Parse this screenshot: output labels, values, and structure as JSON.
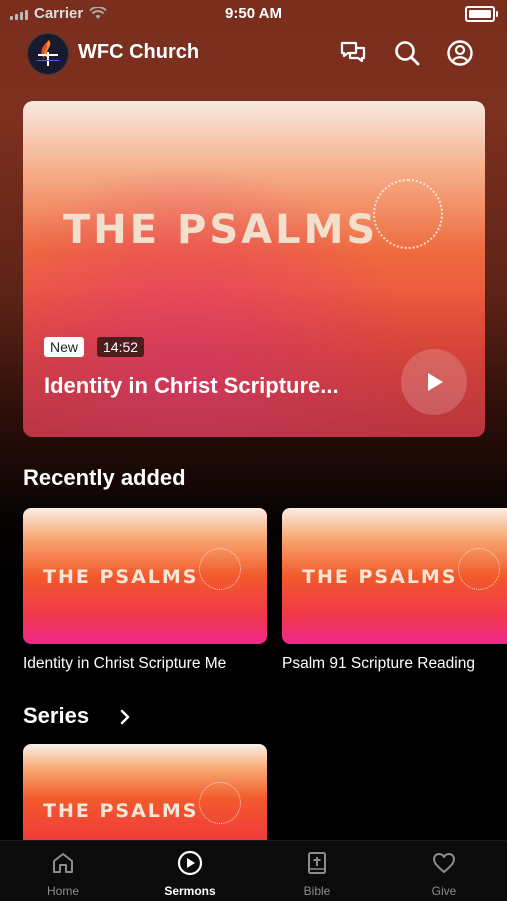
{
  "status_bar": {
    "carrier": "Carrier",
    "time": "9:50 AM"
  },
  "header": {
    "title": "WFC Church"
  },
  "hero": {
    "artwork_title": "THE PSALMS",
    "badge_new": "New",
    "duration": "14:52",
    "title": "Identity in Christ Scripture..."
  },
  "recently_added": {
    "heading": "Recently added",
    "items": [
      {
        "artwork_title": "THE PSALMS",
        "title": "Identity in Christ Scripture Me"
      },
      {
        "artwork_title": "THE PSALMS",
        "title": "Psalm 91 Scripture Reading"
      }
    ]
  },
  "series": {
    "heading": "Series",
    "items": [
      {
        "artwork_title": "THE PSALMS"
      }
    ]
  },
  "tabbar": {
    "active": "Sermons",
    "tabs": [
      {
        "label": "Home",
        "icon": "home-icon"
      },
      {
        "label": "Sermons",
        "icon": "play-circle-icon"
      },
      {
        "label": "Bible",
        "icon": "bible-icon"
      },
      {
        "label": "Give",
        "icon": "heart-icon"
      }
    ]
  },
  "colors": {
    "background_top": "#7a2e1d",
    "tab_inactive": "#8c8c8c",
    "tab_active": "#ffffff"
  }
}
